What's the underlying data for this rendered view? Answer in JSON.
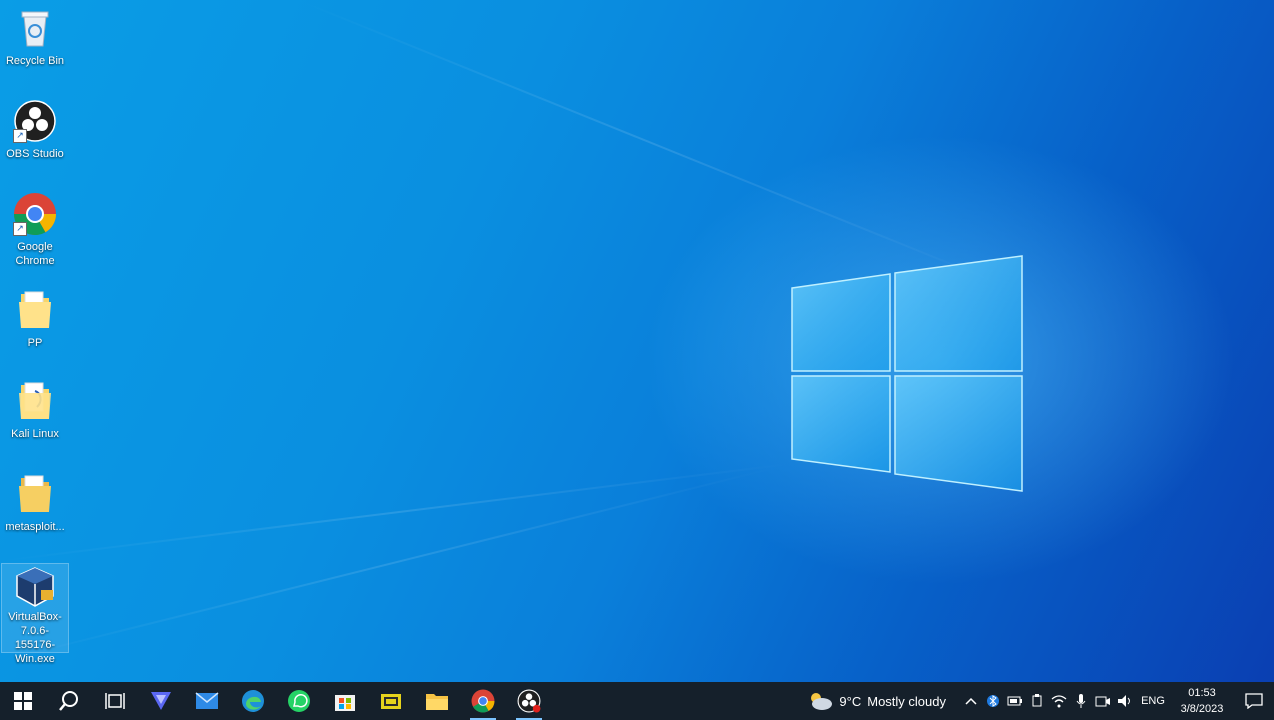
{
  "desktop": {
    "icons": [
      {
        "label": "Recycle Bin",
        "icon": "recycle-bin-icon"
      },
      {
        "label": "OBS Studio",
        "icon": "obs-icon"
      },
      {
        "label": "Google Chrome",
        "icon": "chrome-icon"
      },
      {
        "label": "PP",
        "icon": "folder-icon"
      },
      {
        "label": "Kali Linux",
        "icon": "folder-icon"
      },
      {
        "label": "metasploit...",
        "icon": "folder-icon"
      },
      {
        "label": "VirtualBox-7.0.6-155176-Win.exe",
        "icon": "virtualbox-icon"
      }
    ]
  },
  "taskbar": {
    "apps": [
      {
        "name": "start",
        "icon": "windows-start-icon"
      },
      {
        "name": "search",
        "icon": "search-icon"
      },
      {
        "name": "task-view",
        "icon": "task-view-icon"
      },
      {
        "name": "vpn",
        "icon": "vpn-icon"
      },
      {
        "name": "mail",
        "icon": "mail-icon"
      },
      {
        "name": "edge",
        "icon": "edge-icon"
      },
      {
        "name": "whatsapp",
        "icon": "whatsapp-icon"
      },
      {
        "name": "store",
        "icon": "store-icon"
      },
      {
        "name": "winrar",
        "icon": "winrar-icon"
      },
      {
        "name": "file-explorer",
        "icon": "folder-icon"
      },
      {
        "name": "chrome",
        "icon": "chrome-icon"
      },
      {
        "name": "obs",
        "icon": "obs-icon"
      }
    ],
    "weather": {
      "temp": "9°C",
      "condition": "Mostly cloudy"
    },
    "language": "ENG",
    "time": "01:53",
    "date": "3/8/2023"
  },
  "colors": {
    "taskbar": "#15202b",
    "accent": "#0a8fe0"
  }
}
